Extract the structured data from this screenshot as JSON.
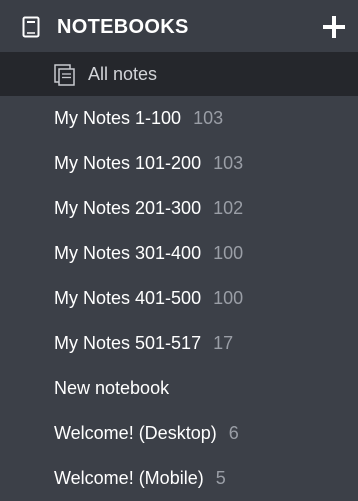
{
  "header": {
    "title": "NOTEBOOKS",
    "icon": "notebook-icon",
    "add_icon": "plus-icon"
  },
  "all_notes": {
    "label": "All notes",
    "icon": "notes-stack-icon"
  },
  "notebooks": [
    {
      "name": "My Notes 1-100",
      "count": "103"
    },
    {
      "name": "My Notes 101-200",
      "count": "103"
    },
    {
      "name": "My Notes 201-300",
      "count": "102"
    },
    {
      "name": "My Notes 301-400",
      "count": "100"
    },
    {
      "name": "My Notes 401-500",
      "count": "100"
    },
    {
      "name": "My Notes 501-517",
      "count": "17"
    },
    {
      "name": "New notebook",
      "count": ""
    },
    {
      "name": "Welcome! (Desktop)",
      "count": "6"
    },
    {
      "name": "Welcome! (Mobile)",
      "count": "5"
    }
  ],
  "colors": {
    "background": "#3c4048",
    "selected_row": "#25272c",
    "count_text": "#9a9ea6"
  }
}
